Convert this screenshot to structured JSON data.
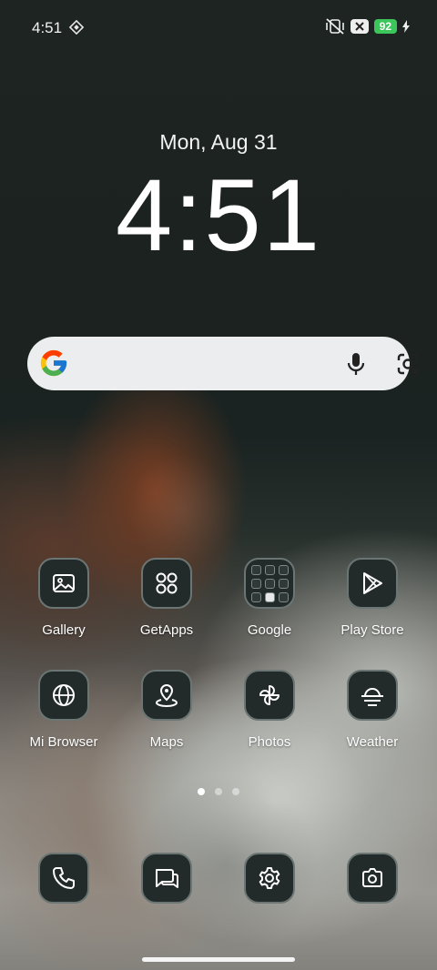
{
  "status_bar": {
    "time": "4:51",
    "battery": "92"
  },
  "clock": {
    "date": "Mon, Aug 31",
    "time": "4:51"
  },
  "search": {
    "logo": "google-g-icon",
    "icons": [
      "mic-icon",
      "lens-icon"
    ]
  },
  "apps": [
    {
      "label": "Gallery",
      "icon": "gallery-icon"
    },
    {
      "label": "GetApps",
      "icon": "getapps-icon"
    },
    {
      "label": "Google",
      "icon": "folder-icon"
    },
    {
      "label": "Play Store",
      "icon": "play-store-icon"
    },
    {
      "label": "Mi Browser",
      "icon": "globe-icon"
    },
    {
      "label": "Maps",
      "icon": "map-pin-icon"
    },
    {
      "label": "Photos",
      "icon": "pinwheel-icon"
    },
    {
      "label": "Weather",
      "icon": "weather-icon"
    }
  ],
  "dock": [
    {
      "icon": "phone-icon"
    },
    {
      "icon": "messages-icon"
    },
    {
      "icon": "settings-icon"
    },
    {
      "icon": "camera-icon"
    }
  ],
  "page_indicator": {
    "pages": 3,
    "current": 1
  },
  "colors": {
    "icon_bg": "#222b2a",
    "battery": "#3bc55a",
    "search_bg": "#ecedee"
  }
}
